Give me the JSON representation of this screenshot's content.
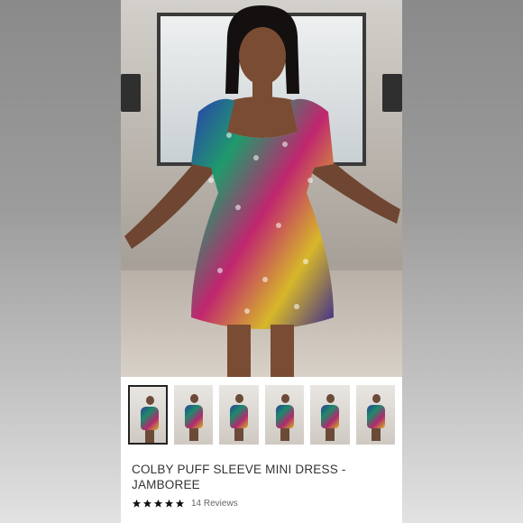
{
  "product": {
    "title": "COLBY PUFF SLEEVE MINI DRESS - JAMBOREE",
    "rating": 5,
    "reviews_label": "14 Reviews"
  },
  "gallery": {
    "thumbnail_count": 6,
    "selected_index": 0
  },
  "colors": {
    "star": "#111111",
    "title_text": "#333333",
    "selected_border": "#222222"
  }
}
